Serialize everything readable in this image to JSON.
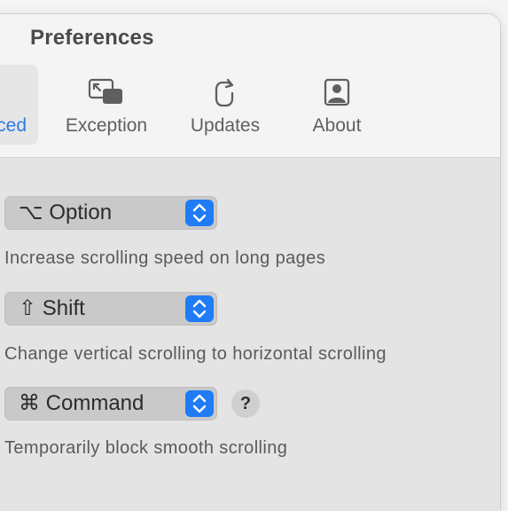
{
  "window": {
    "title": "Preferences"
  },
  "toolbar": {
    "tabs": [
      {
        "label": "Advanced",
        "visible_label": "ced",
        "icon": "advanced-icon",
        "selected": true
      },
      {
        "label": "Exception",
        "icon": "exception-icon",
        "selected": false
      },
      {
        "label": "Updates",
        "icon": "updates-icon",
        "selected": false
      },
      {
        "label": "About",
        "icon": "about-icon",
        "selected": false
      }
    ]
  },
  "settings": [
    {
      "modifier": "⌥ Option",
      "description": "Increase scrolling speed on long pages",
      "has_help": false
    },
    {
      "modifier": "⇧ Shift",
      "description": "Change vertical scrolling to horizontal scrolling",
      "has_help": false
    },
    {
      "modifier": "⌘ Command",
      "description": "Temporarily block smooth scrolling",
      "has_help": true,
      "help_label": "?"
    }
  ],
  "colors": {
    "accent": "#1f7cf5",
    "selected_tab_text": "#2a7be4",
    "content_background": "#e4e4e4",
    "toolbar_background": "#f4f4f4"
  }
}
